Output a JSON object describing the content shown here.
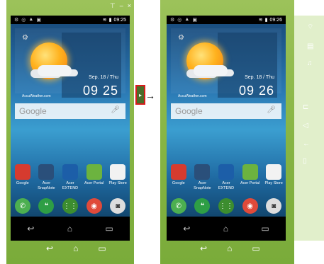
{
  "window_buttons": [
    "⊤",
    "–",
    "×"
  ],
  "left": {
    "status": {
      "icons": [
        "⚙",
        "◎",
        "▲",
        "▣"
      ],
      "time": "09:25"
    },
    "date": "Sep. 18 / Thu",
    "clock": "09 25",
    "accu": "AccuWeather.com"
  },
  "right": {
    "status": {
      "icons": [
        "⚙",
        "◎",
        "▲",
        "▣"
      ],
      "time": "09:26"
    },
    "date": "Sep. 18 / Thu",
    "clock": "09 26",
    "accu": "AccuWeather.com"
  },
  "search": {
    "label": "Google"
  },
  "apps": [
    {
      "label": "Google",
      "color": "#d63b2f"
    },
    {
      "label": "Acer SnapNote",
      "color": "#2a4f7a"
    },
    {
      "label": "Acer EXTEND",
      "color": "#1c5ea8"
    },
    {
      "label": "Acer Portal",
      "color": "#6cb33f"
    },
    {
      "label": "Play Store",
      "color": "#f2f2f2"
    }
  ],
  "dock": [
    {
      "name": "phone-icon",
      "glyph": "✆",
      "color": "#4caf50"
    },
    {
      "name": "hangouts-icon",
      "glyph": "❝",
      "color": "#2e9e45"
    },
    {
      "name": "app-drawer-icon",
      "glyph": "⋮⋮",
      "color": "#3c8d2f"
    },
    {
      "name": "chrome-icon",
      "glyph": "◉",
      "color": "#e04a3a"
    },
    {
      "name": "camera-icon",
      "glyph": "◙",
      "color": "#dddddd"
    }
  ],
  "nav": {
    "back": "↩",
    "home": "⌂",
    "recent": "▭"
  },
  "toggle": {
    "glyph": "▸",
    "arrow": "→"
  },
  "side_panel": [
    "⌔",
    "▤",
    "♫",
    "⊏",
    "◁",
    "←",
    "▯"
  ]
}
